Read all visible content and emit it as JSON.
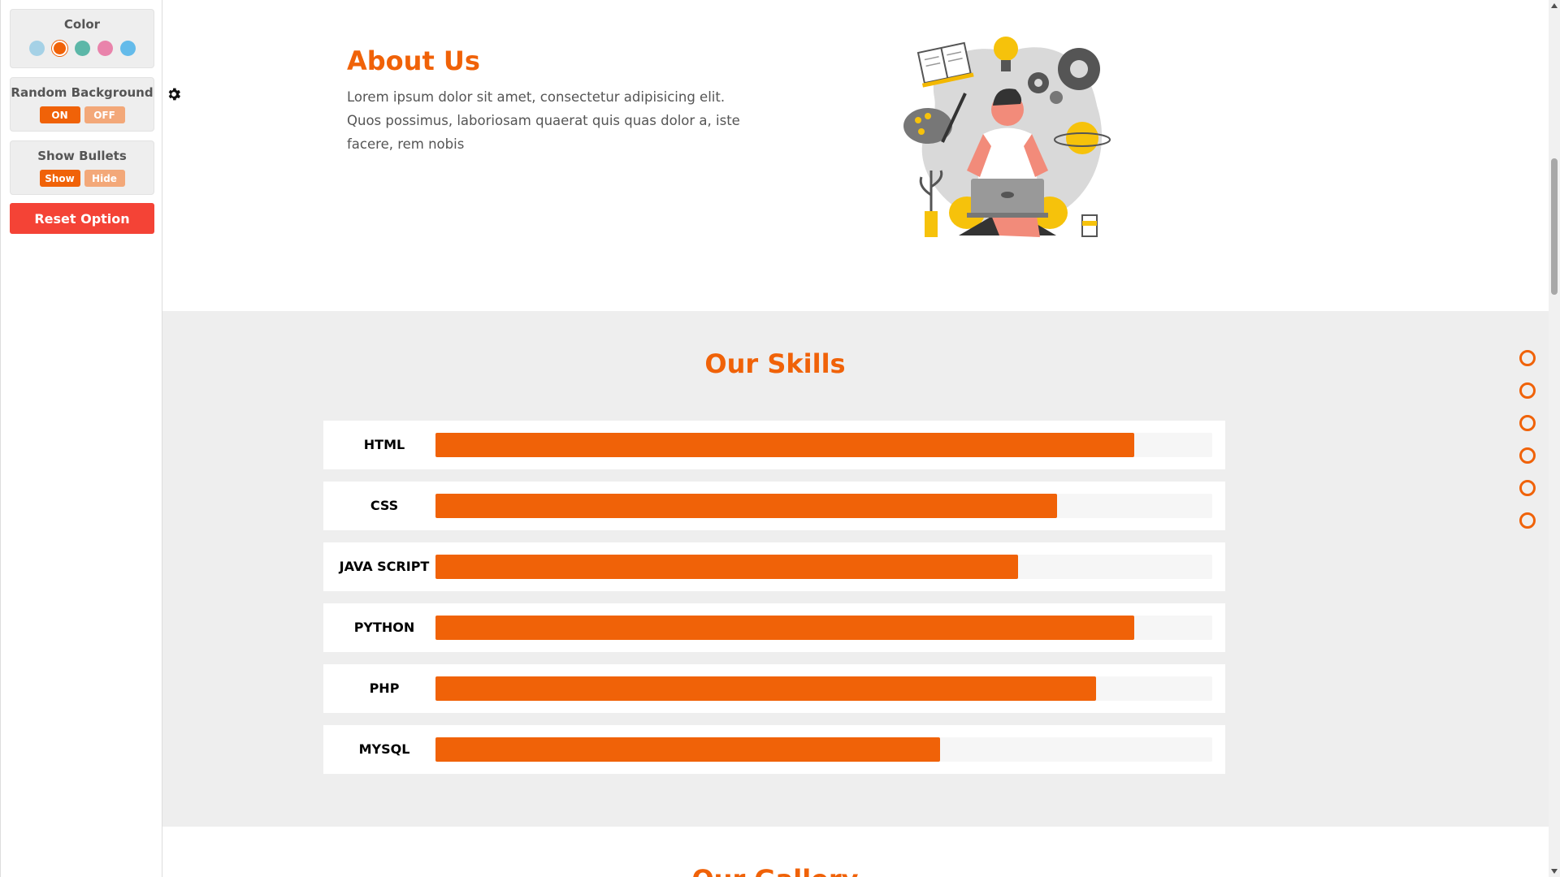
{
  "settings": {
    "color_title": "Color",
    "colors": [
      "#a5d1e6",
      "#f06208",
      "#5cb7a8",
      "#e983ab",
      "#64bbea"
    ],
    "active_color": "#f06208",
    "random_bg": {
      "title": "Random Background",
      "on_label": "ON",
      "off_label": "OFF"
    },
    "bullets": {
      "title": "Show Bullets",
      "show_label": "Show",
      "hide_label": "Hide"
    },
    "reset_label": "Reset Option"
  },
  "about": {
    "title": "About Us",
    "text": "Lorem ipsum dolor sit amet, consectetur adipisicing elit. Quos possimus, laboriosam quaerat quis quas dolor a, iste facere, rem nobis"
  },
  "skills": {
    "title": "Our Skills",
    "items": [
      {
        "name": "HTML",
        "percent": 90
      },
      {
        "name": "CSS",
        "percent": 80
      },
      {
        "name": "JAVA SCRIPT",
        "percent": 75
      },
      {
        "name": "PYTHON",
        "percent": 90
      },
      {
        "name": "PHP",
        "percent": 85
      },
      {
        "name": "MYSQL",
        "percent": 65
      }
    ]
  },
  "next_section": {
    "title": "Our Gallery"
  },
  "nav_bullets_count": 6,
  "accent_color": "#f06208"
}
